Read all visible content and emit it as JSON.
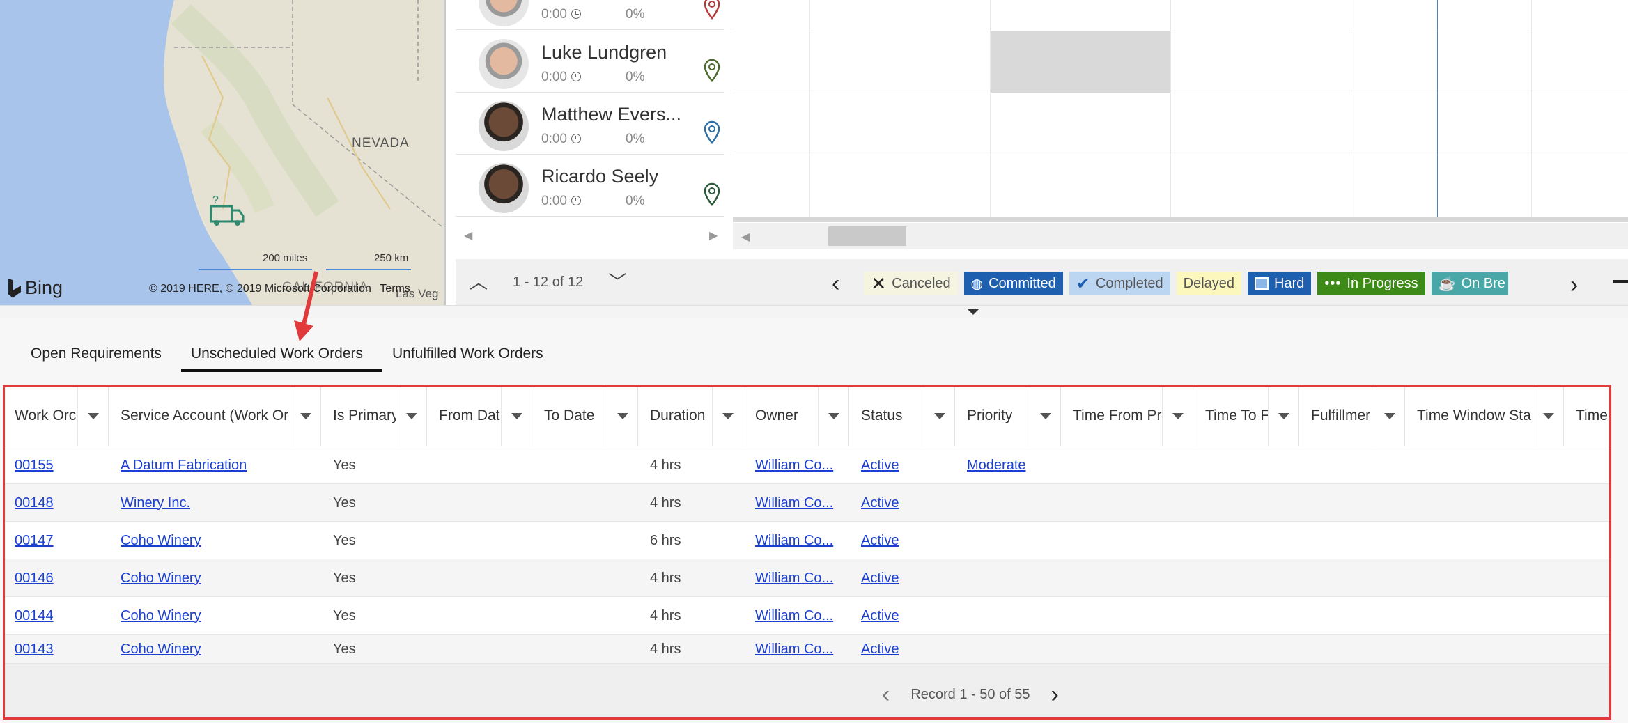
{
  "map": {
    "state_label_1": "NEVADA",
    "state_label_2": "CALIFORNIA",
    "city_label": "Las Veg",
    "scale_miles": "200 miles",
    "scale_km": "250 km",
    "brand": "Bing",
    "copyright": "© 2019 HERE, © 2019 Microsoft Corporation",
    "terms": "Terms",
    "colors": {
      "water": "#a9c4ea",
      "land": "#e9e4d6",
      "truck": "#2e8a6e"
    }
  },
  "resources": [
    {
      "name": "",
      "hours": "0:00",
      "utilization": "0%",
      "pin_color": "#b23a3a"
    },
    {
      "name": "Luke Lundgren",
      "hours": "0:00",
      "utilization": "0%",
      "pin_color": "#4a6a2a"
    },
    {
      "name": "Matthew Evers...",
      "hours": "0:00",
      "utilization": "0%",
      "pin_color": "#2b6fa8"
    },
    {
      "name": "Ricardo Seely",
      "hours": "0:00",
      "utilization": "0%",
      "pin_color": "#2a5a3a"
    }
  ],
  "resource_pager": {
    "range": "1 - 12 of 12"
  },
  "legend": [
    {
      "label": "Canceled",
      "icon": "x-icon",
      "bg": "#f4f4e0",
      "fg": "#555"
    },
    {
      "label": "Committed",
      "icon": "globe-icon",
      "bg": "#1f5fb0",
      "fg": "#ffffff"
    },
    {
      "label": "Completed",
      "icon": "check-icon",
      "bg": "#bcd6f2",
      "fg": "#555"
    },
    {
      "label": "Delayed",
      "icon": "",
      "bg": "#fbf7bd",
      "fg": "#555"
    },
    {
      "label": "Hard",
      "icon": "image-icon",
      "bg": "#1f5fb0",
      "fg": "#ffffff"
    },
    {
      "label": "In Progress",
      "icon": "dots-icon",
      "bg": "#3d8a19",
      "fg": "#ffffff"
    },
    {
      "label": "On Bre",
      "icon": "coffee-icon",
      "bg": "#4aa7a7",
      "fg": "#ffffff"
    }
  ],
  "tabs": [
    {
      "label": "Open Requirements"
    },
    {
      "label": "Unscheduled Work Orders"
    },
    {
      "label": "Unfulfilled Work Orders"
    }
  ],
  "columns": [
    "Work Orc",
    "Service Account (Work Or",
    "Is Primary",
    "From Dat",
    "To Date",
    "Duration",
    "Owner",
    "Status",
    "Priority",
    "Time From Pr",
    "Time To F",
    "Fulfillmer",
    "Time Window Sta",
    "Time Wi"
  ],
  "rows": [
    {
      "wo": "00155",
      "account": "A Datum Fabrication",
      "primary": "Yes",
      "duration": "4 hrs",
      "owner": "William Co...",
      "status": "Active",
      "priority": "Moderate"
    },
    {
      "wo": "00148",
      "account": "Winery Inc.",
      "primary": "Yes",
      "duration": "4 hrs",
      "owner": "William Co...",
      "status": "Active",
      "priority": ""
    },
    {
      "wo": "00147",
      "account": "Coho Winery",
      "primary": "Yes",
      "duration": "6 hrs",
      "owner": "William Co...",
      "status": "Active",
      "priority": ""
    },
    {
      "wo": "00146",
      "account": "Coho Winery",
      "primary": "Yes",
      "duration": "4 hrs",
      "owner": "William Co...",
      "status": "Active",
      "priority": ""
    },
    {
      "wo": "00144",
      "account": "Coho Winery",
      "primary": "Yes",
      "duration": "4 hrs",
      "owner": "William Co...",
      "status": "Active",
      "priority": ""
    },
    {
      "wo": "00143",
      "account": "Coho Winery",
      "primary": "Yes",
      "duration": "4 hrs",
      "owner": "William Co...",
      "status": "Active",
      "priority": ""
    }
  ],
  "record_pager": {
    "text": "Record 1 - 50 of 55"
  },
  "annotation_color": "#e03a3a"
}
